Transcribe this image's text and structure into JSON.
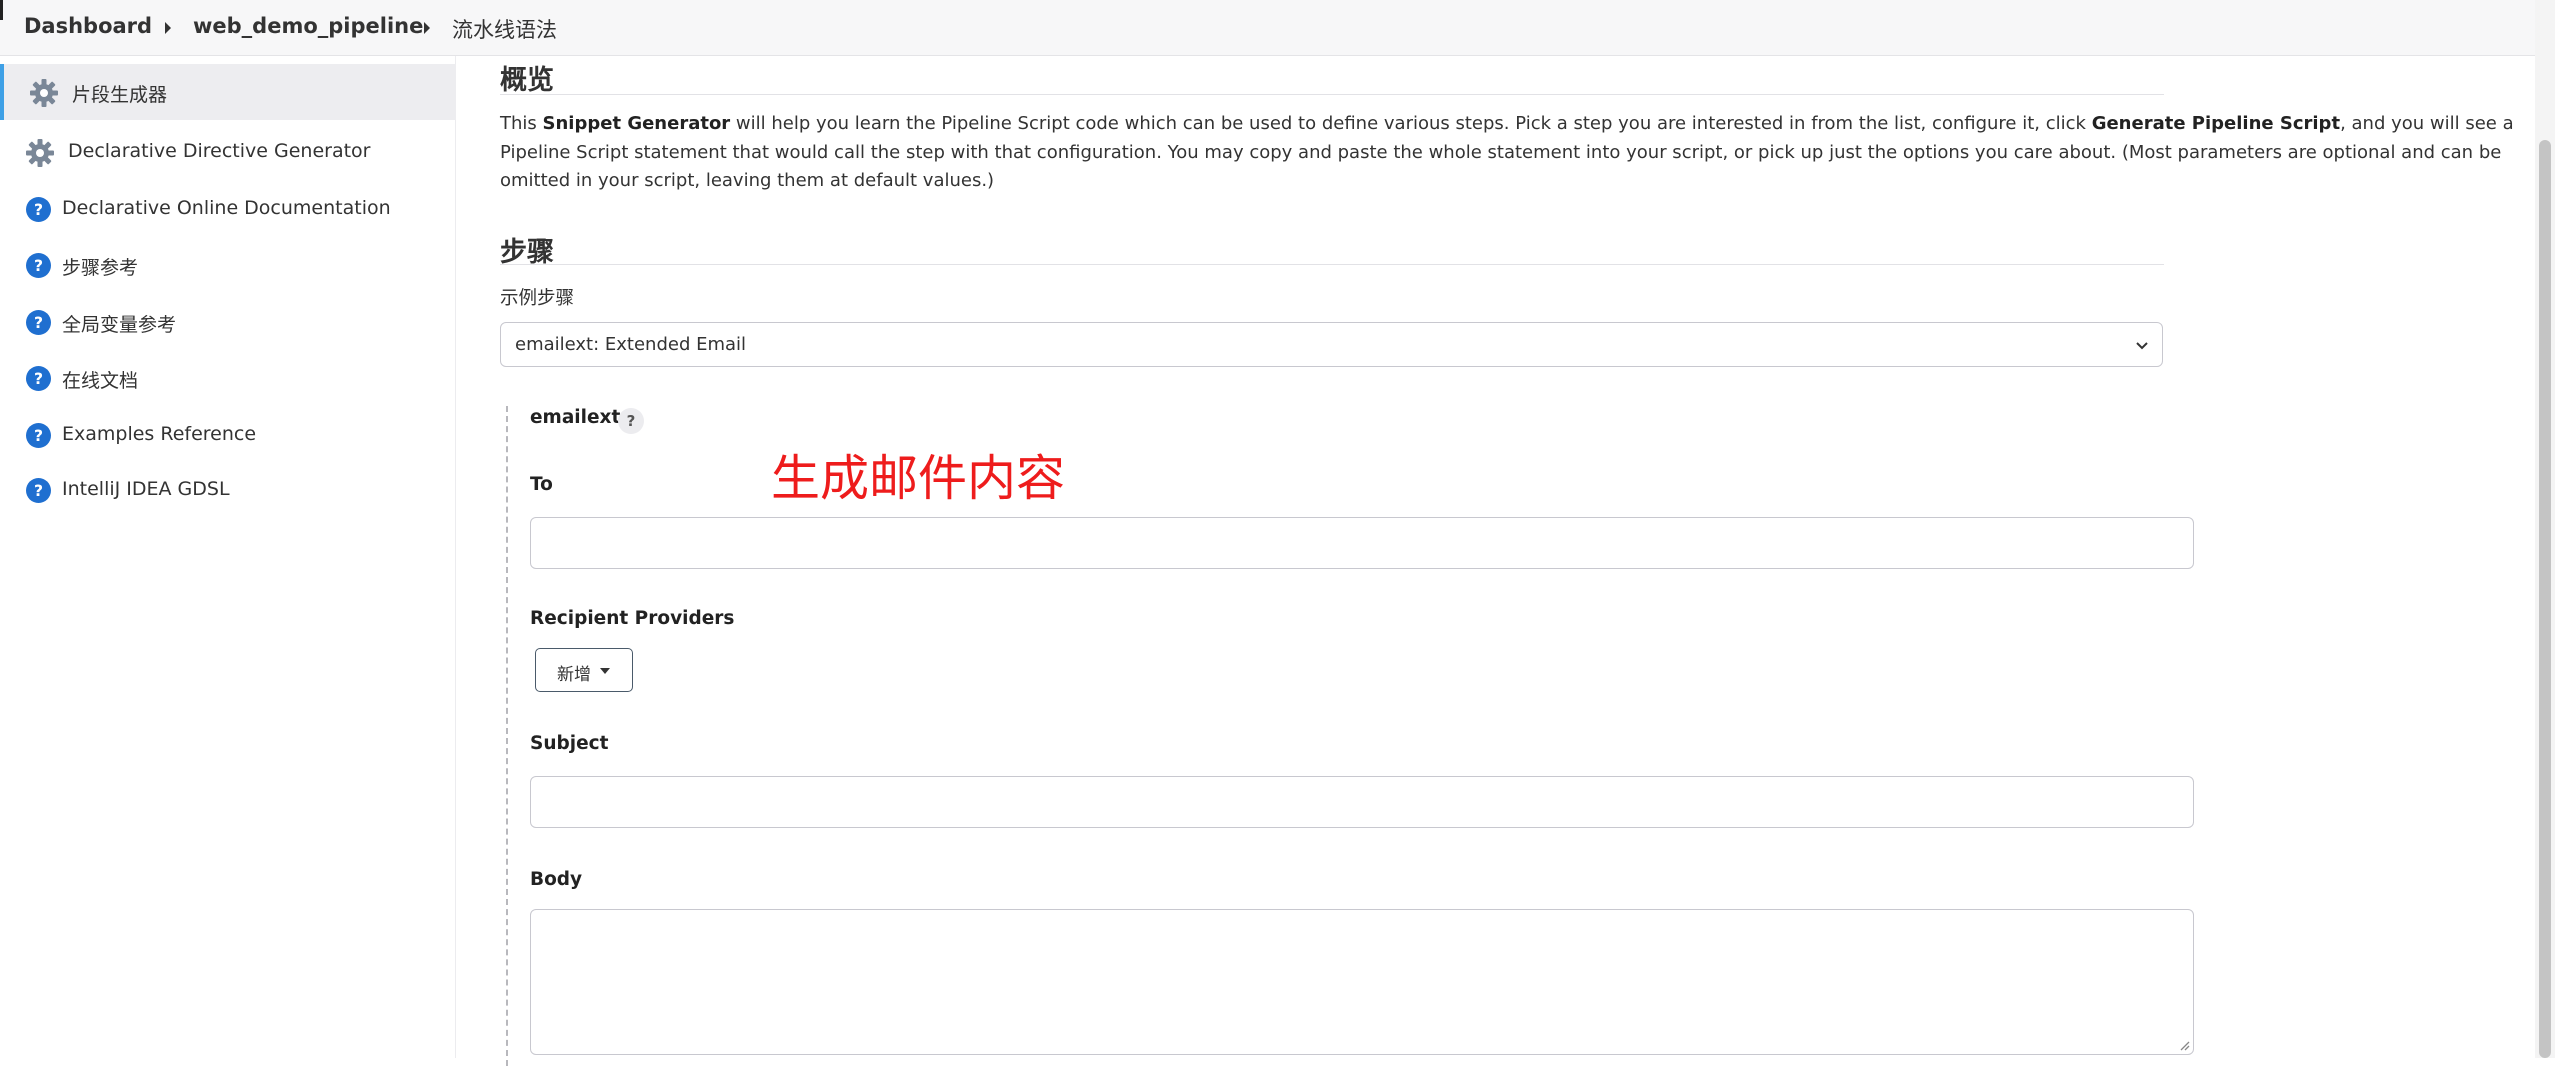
{
  "breadcrumb": {
    "items": [
      "Dashboard",
      "web_demo_pipeline",
      "流水线语法"
    ]
  },
  "sidebar": {
    "items": [
      {
        "label": "片段生成器",
        "icon": "gear-icon",
        "active": true
      },
      {
        "label": "Declarative Directive Generator",
        "icon": "gear-icon",
        "active": false
      },
      {
        "label": "Declarative Online Documentation",
        "icon": "help-circle-icon",
        "active": false
      },
      {
        "label": "步骤参考",
        "icon": "help-circle-icon",
        "active": false
      },
      {
        "label": "全局变量参考",
        "icon": "help-circle-icon",
        "active": false
      },
      {
        "label": "在线文档",
        "icon": "help-circle-icon",
        "active": false
      },
      {
        "label": "Examples Reference",
        "icon": "help-circle-icon",
        "active": false
      },
      {
        "label": "IntelliJ IDEA GDSL",
        "icon": "help-circle-icon",
        "active": false
      }
    ]
  },
  "overview": {
    "title": "概览",
    "text_1": "This ",
    "bold_1": "Snippet Generator",
    "text_2": " will help you learn the Pipeline Script code which can be used to define various steps. Pick a step you are interested in from the list, configure it, click ",
    "bold_2": "Generate Pipeline Script",
    "text_3": ", and you will see a Pipeline Script statement that would call the step with that configuration. You may copy and paste the whole statement into your script, or pick up just the options you care about. (Most parameters are optional and can be omitted in your script, leaving them at default values.)"
  },
  "steps": {
    "title": "步骤",
    "sample_label": "示例步骤",
    "selected_step": "emailext: Extended Email"
  },
  "step_form": {
    "name": "emailext",
    "help": "?",
    "to_label": "To",
    "to_value": "",
    "recipient_label": "Recipient Providers",
    "add_button": "新增",
    "subject_label": "Subject",
    "subject_value": "",
    "body_label": "Body",
    "body_value": ""
  },
  "annotation": {
    "text": "生成邮件内容",
    "color": "#ee1c1c"
  },
  "colors": {
    "accent": "#3ea0e6",
    "help_icon": "#1f6fd0"
  }
}
